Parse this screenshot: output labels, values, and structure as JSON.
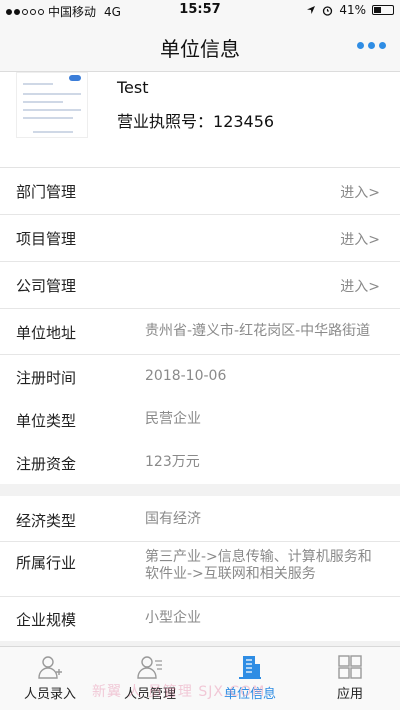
{
  "status": {
    "carrier": "中国移动",
    "network": "4G",
    "time": "15:57",
    "battery": "41%",
    "battery_level": 0.41
  },
  "nav": {
    "title": "单位信息",
    "more_icon": "more-dots-icon",
    "accent": "#2f8de4"
  },
  "company": {
    "name": "Test",
    "license_label": "营业执照号：",
    "license_number": "123456"
  },
  "management": [
    {
      "label": "部门管理",
      "action": "进入>"
    },
    {
      "label": "项目管理",
      "action": "进入>"
    },
    {
      "label": "公司管理",
      "action": "进入>"
    }
  ],
  "info": [
    {
      "label": "单位地址",
      "value": "贵州省-遵义市-红花岗区-中华路街道"
    },
    {
      "label": "注册时间",
      "value": "2018-10-06"
    },
    {
      "label": "单位类型",
      "value": "民营企业"
    },
    {
      "label": "注册资金",
      "value": "123万元"
    }
  ],
  "business": [
    {
      "label": "经济类型",
      "value": "国有经济"
    },
    {
      "label": "所属行业",
      "value": "第三产业->信息传输、计算机服务和软件业->互联网和相关服务"
    },
    {
      "label": "企业规模",
      "value": "小型企业"
    }
  ],
  "tabs": [
    {
      "label": "人员录入",
      "icon": "person-add-icon",
      "active": false
    },
    {
      "label": "人员管理",
      "icon": "person-list-icon",
      "active": false
    },
    {
      "label": "单位信息",
      "icon": "building-icon",
      "active": true
    },
    {
      "label": "应用",
      "icon": "grid-apps-icon",
      "active": false
    }
  ],
  "watermark": "新翼  人  员管理 SJX.COM"
}
